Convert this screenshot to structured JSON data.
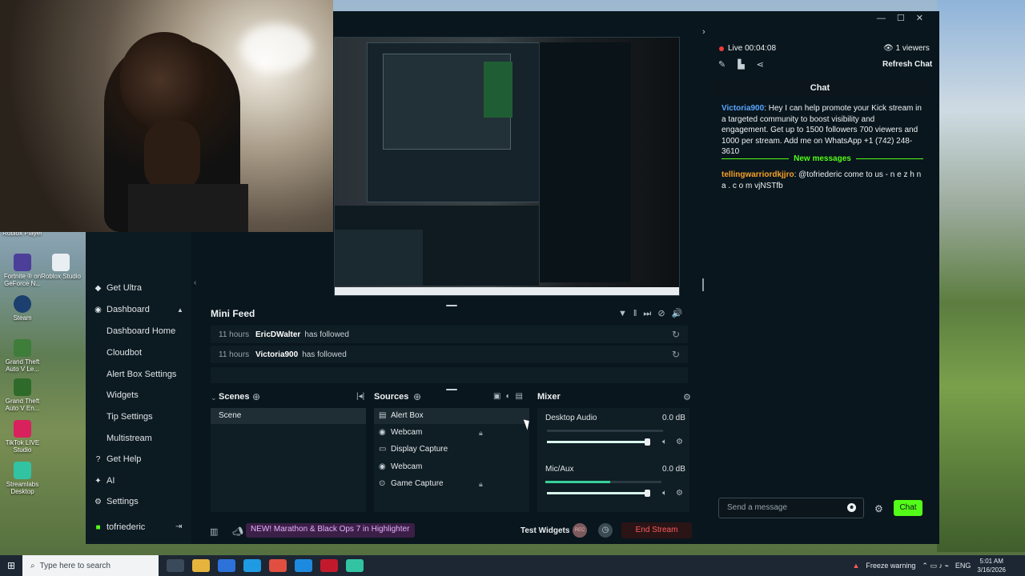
{
  "desktop": {
    "icons": [
      {
        "label": "Roblox Player"
      },
      {
        "label": "Fortnite ® on GeForce N..."
      },
      {
        "label": "Roblox Studio"
      },
      {
        "label": "Steam"
      },
      {
        "label": "Grand Theft Auto V Le..."
      },
      {
        "label": "Grand Theft Auto V En..."
      },
      {
        "label": "TikTok LIVE Studio"
      },
      {
        "label": "Streamlabs Desktop"
      }
    ]
  },
  "sidebar": {
    "items": [
      {
        "label": "Get Ultra"
      },
      {
        "label": "Dashboard"
      },
      {
        "label": "Dashboard Home"
      },
      {
        "label": "Cloudbot"
      },
      {
        "label": "Alert Box Settings"
      },
      {
        "label": "Widgets"
      },
      {
        "label": "Tip Settings"
      },
      {
        "label": "Multistream"
      },
      {
        "label": "Get Help"
      },
      {
        "label": "AI"
      },
      {
        "label": "Settings"
      },
      {
        "label": "tofriederic"
      }
    ]
  },
  "minifeed": {
    "title": "Mini Feed",
    "rows": [
      {
        "time": "11 hours",
        "user": "EricDWalter",
        "action": "has followed"
      },
      {
        "time": "11 hours",
        "user": "Victoria900",
        "action": "has followed"
      }
    ]
  },
  "scenes": {
    "title": "Scenes",
    "items": [
      "Scene"
    ]
  },
  "sources": {
    "title": "Sources",
    "items": [
      "Alert Box",
      "Webcam",
      "Display Capture",
      "Webcam",
      "Game Capture"
    ]
  },
  "mixer": {
    "title": "Mixer",
    "channels": [
      {
        "name": "Desktop Audio",
        "db": "0.0 dB"
      },
      {
        "name": "Mic/Aux",
        "db": "0.0 dB"
      }
    ]
  },
  "bottombar": {
    "promo": "NEW! Marathon & Black Ops 7 in Highlighter",
    "test_widgets": "Test Widgets",
    "rec": "REC",
    "end_stream": "End Stream"
  },
  "chat": {
    "live": "Live 00:04:08",
    "viewers": "1 viewers",
    "refresh": "Refresh Chat",
    "title": "Chat",
    "messages": [
      {
        "user": "Victoria900",
        "text": ": Hey I can help promote your Kick stream in a targeted community to boost visibility and engagement. Get up to 1500 followers 700 viewers and 1000 per stream. Add me on WhatsApp +1 (742) 248-3610"
      },
      {
        "user": "tellingwarriordkjjro",
        "text": ": @tofriederic come to us - n e z h n a . c o m vjNSTfb"
      }
    ],
    "new_messages": "New messages",
    "input_placeholder": "Send a message",
    "send": "Chat"
  },
  "taskbar": {
    "search_placeholder": "Type here to search",
    "freeze": "Freeze warning",
    "lang": "ENG",
    "time": "5:01 AM",
    "date": "3/16/2026"
  }
}
